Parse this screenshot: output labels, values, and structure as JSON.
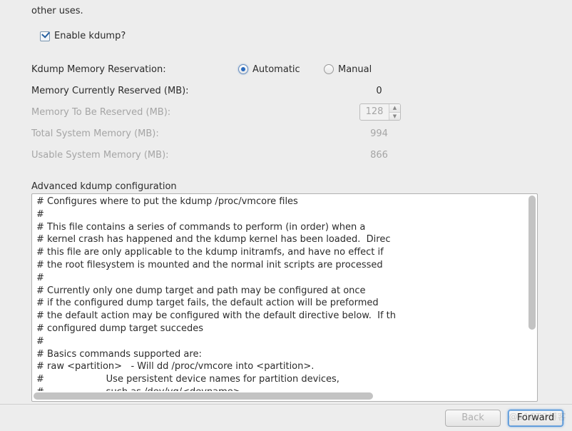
{
  "top_text": "other uses.",
  "checkbox": {
    "label": "Enable kdump?",
    "checked": true
  },
  "fields": {
    "reservation_label": "Kdump Memory Reservation:",
    "radio_auto": "Automatic",
    "radio_manual": "Manual",
    "radio_selected": "auto",
    "currently_reserved_label": "Memory Currently Reserved (MB):",
    "currently_reserved_value": "0",
    "to_be_reserved_label": "Memory To Be Reserved (MB):",
    "to_be_reserved_value": "128",
    "total_memory_label": "Total System Memory (MB):",
    "total_memory_value": "994",
    "usable_memory_label": "Usable System Memory (MB):",
    "usable_memory_value": "866"
  },
  "advanced": {
    "title": "Advanced kdump configuration",
    "text": "# Configures where to put the kdump /proc/vmcore files\n#\n# This file contains a series of commands to perform (in order) when a\n# kernel crash has happened and the kdump kernel has been loaded.  Direc\n# this file are only applicable to the kdump initramfs, and have no effect if\n# the root filesystem is mounted and the normal init scripts are processed\n#\n# Currently only one dump target and path may be configured at once\n# if the configured dump target fails, the default action will be preformed\n# the default action may be configured with the default directive below.  If th\n# configured dump target succedes\n#\n# Basics commands supported are:\n# raw <partition>   - Will dd /proc/vmcore into <partition>.\n#                     Use persistent device names for partition devices,\n#                     such as /dev/vg/<devname>.\n#\n# nfs <nfs mount>        - Will mount fs and copy /proc/vmcore to\n#                     <mnt>/var/crash/%HOST-%DATE/, supports DNS."
  },
  "footer": {
    "back": "Back",
    "forward": "Forward"
  }
}
